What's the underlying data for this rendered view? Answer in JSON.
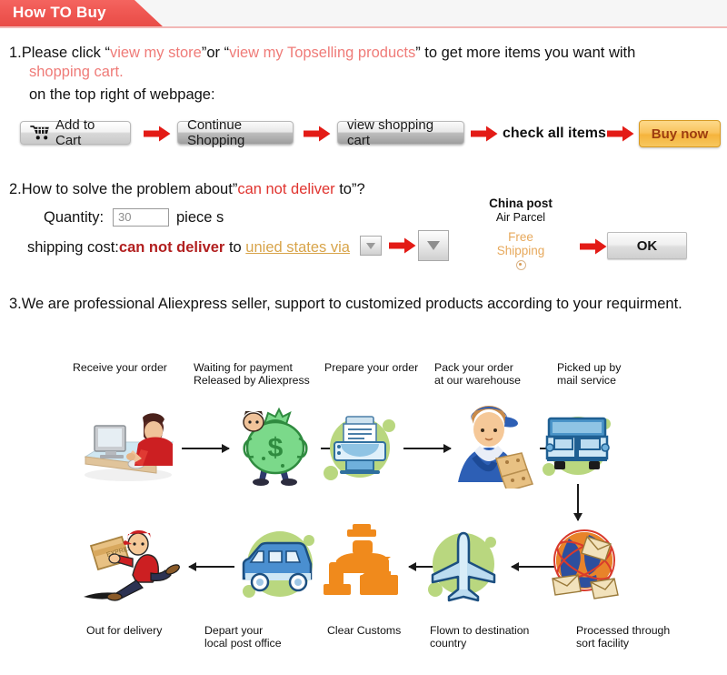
{
  "banner": {
    "title": "How TO Buy"
  },
  "step1": {
    "num": "1.",
    "line1_a": "Please click “",
    "line1_link1": "view my store",
    "line1_b": "”or “",
    "line1_link2": "view my Topselling products",
    "line1_c": "” to get more items you want with",
    "line2_link": "shopping cart.",
    "line3": "on the top right of webpage:",
    "buttons": {
      "add_to_cart": "Add to Cart",
      "continue_shopping": "Continue Shopping",
      "view_shopping_cart": "view shopping cart",
      "check_all_items": "check all items",
      "buy_now": "Buy now"
    },
    "cart_icon": "shopping-cart-icon",
    "arrow_icon": "red-right-arrow-icon"
  },
  "step2": {
    "num": "2.",
    "heading_a": "How to solve the problem about”",
    "heading_red": "can not deliver",
    "heading_b": " to”?",
    "quantity_label": "Quantity:",
    "quantity_value": "30",
    "quantity_unit": "piece s",
    "shipping_label": "shipping cost:",
    "shipping_red": "can not deliver",
    "shipping_to": " to ",
    "shipping_country": "unied states via",
    "dropdown_icon": "chevron-down-icon",
    "carrier_name": "China post",
    "carrier_service": "Air Parcel",
    "free_shipping_line1": "Free",
    "free_shipping_line2": "Shipping",
    "free_shipping_radio": "radio-selected-icon",
    "ok_button": "OK"
  },
  "step3": {
    "num": "3.",
    "text": "We are professional Aliexpress seller, support to customized products according to your requirment."
  },
  "flow": {
    "top_row": [
      {
        "caption": "Receive your order",
        "icon": "person-at-computer-icon"
      },
      {
        "caption": "Waiting for payment\nReleased by Aliexpress",
        "icon": "money-bag-icon"
      },
      {
        "caption": "Prepare your order",
        "icon": "printer-icon"
      },
      {
        "caption": "Pack your order\nat our warehouse",
        "icon": "worker-packing-boxes-icon"
      },
      {
        "caption": "Picked up by\nmail service",
        "icon": "truck-icon"
      }
    ],
    "bottom_row": [
      {
        "caption": "Out for delivery",
        "icon": "running-courier-icon"
      },
      {
        "caption": "Depart your\nlocal post office",
        "icon": "delivery-van-icon"
      },
      {
        "caption": "Clear Customs",
        "icon": "customs-officer-icon"
      },
      {
        "caption": "Flown to destination\ncountry",
        "icon": "airplane-icon"
      },
      {
        "caption": "Processed through\nsort facility",
        "icon": "mail-sorting-globe-icon"
      }
    ]
  },
  "colors": {
    "banner_red": "#ee5550",
    "pink_text": "#ef7b78",
    "red_text": "#e0332e",
    "dark_red_text": "#b22020",
    "orange_link": "#d8a44a",
    "free_shipping_orange": "#e7a95c",
    "buy_now_text": "#9d3c10",
    "blob_green": "#b9d77f"
  }
}
